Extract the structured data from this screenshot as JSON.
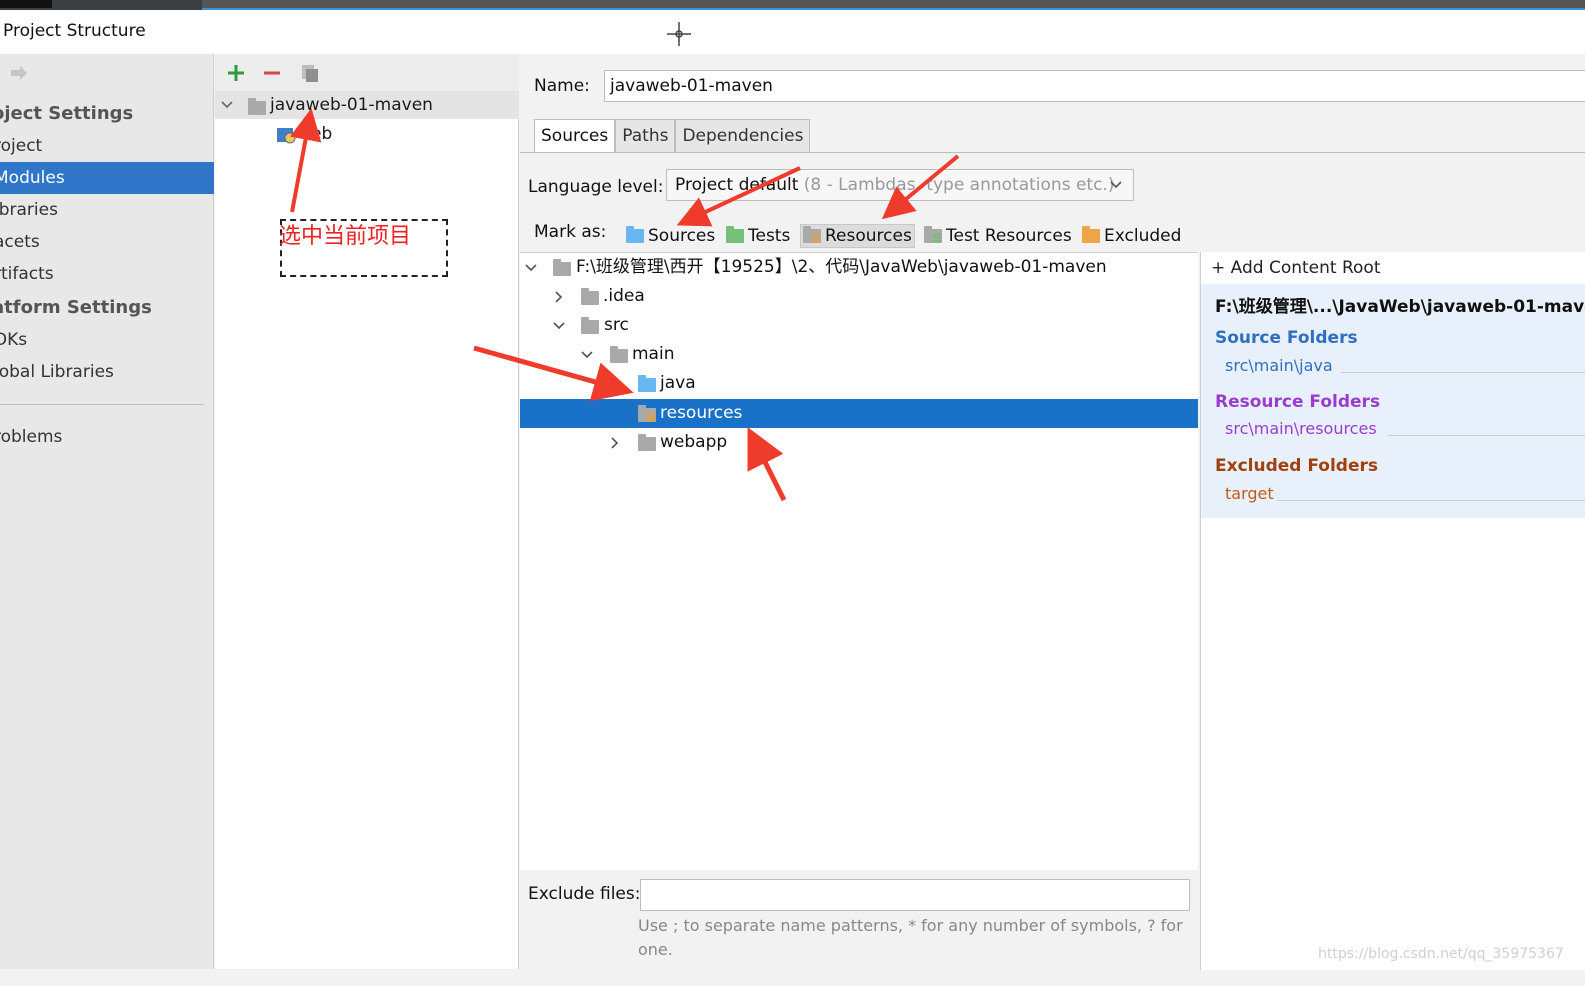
{
  "window": {
    "title": "Project Structure"
  },
  "sidebar": {
    "headers": [
      "oject Settings",
      "atform Settings"
    ],
    "items": [
      {
        "label": "roject"
      },
      {
        "label": "Modules"
      },
      {
        "label": "ibraries"
      },
      {
        "label": "acets"
      },
      {
        "label": "rtifacts"
      },
      {
        "label": "DKs"
      },
      {
        "label": "lobal Libraries"
      },
      {
        "label": "roblems"
      }
    ]
  },
  "modules": {
    "tree": [
      {
        "label": "javaweb-01-maven"
      },
      {
        "label": "eb"
      }
    ],
    "annotation": "选中当前项目"
  },
  "main": {
    "name_label": "Name:",
    "name_value": "javaweb-01-maven",
    "tabs": [
      "Sources",
      "Paths",
      "Dependencies"
    ],
    "language_label": "Language level:",
    "language_value": "Project default",
    "language_hint": "(8 - Lambdas, type annotations etc.)",
    "mark_as_label": "Mark as:",
    "mark_as": [
      "Sources",
      "Tests",
      "Resources",
      "Test Resources",
      "Excluded"
    ],
    "tree": [
      {
        "label": "F:\\班级管理\\西开【19525】\\2、代码\\JavaWeb\\javaweb-01-maven"
      },
      {
        "label": ".idea"
      },
      {
        "label": "src"
      },
      {
        "label": "main"
      },
      {
        "label": "java"
      },
      {
        "label": "resources"
      },
      {
        "label": "webapp"
      }
    ],
    "exclude_label": "Exclude files:",
    "exclude_value": "",
    "exclude_hint": "Use ; to separate name patterns, * for any number of symbols, ? for one."
  },
  "content_root": {
    "add_label": "Add Content Root",
    "path": "F:\\班级管理\\...\\JavaWeb\\javaweb-01-mave",
    "source_header": "Source Folders",
    "source_value": "src\\main\\java",
    "resource_header": "Resource Folders",
    "resource_value": "src\\main\\resources",
    "excluded_header": "Excluded Folders",
    "excluded_value": "target"
  },
  "watermark": "https://blog.csdn.net/qq_35975367",
  "colors": {
    "selection": "#1a72c8",
    "source_header": "#2f6fc0",
    "resource_header": "#9a3ccf",
    "excluded_header": "#a0410c",
    "annotation": "#e22222"
  }
}
